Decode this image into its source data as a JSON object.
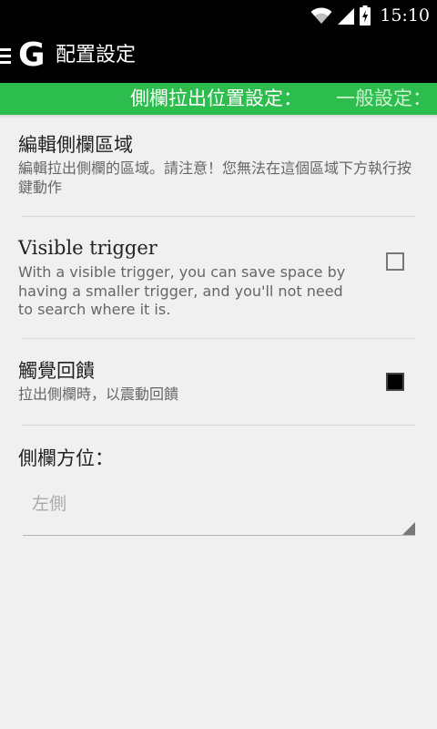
{
  "status_bar": {
    "time": "15:10",
    "icons": [
      "wifi-icon",
      "cell-signal-icon",
      "battery-charging-icon"
    ]
  },
  "action_bar": {
    "menu_icon": "hamburger-icon",
    "logo": "G",
    "title": "配置設定"
  },
  "tabs": {
    "active": "側欄拉出位置設定：",
    "inactive": "一般設定："
  },
  "preferences": {
    "edit_area": {
      "title": "編輯側欄區域",
      "summary": "編輯拉出側欄的區域。請注意！您無法在這個區域下方執行按鍵動作"
    },
    "visible_trigger": {
      "title": "Visible trigger",
      "summary": "With a visible trigger, you can save space by having a smaller trigger, and you'll not need to search where it is.",
      "checked": false
    },
    "haptic_feedback": {
      "title": "觸覺回饋",
      "summary": "拉出側欄時，以震動回饋",
      "checked": true
    },
    "sidebar_side": {
      "title": "側欄方位：",
      "value": "左側"
    }
  },
  "colors": {
    "tab_strip": "#2dbd4e",
    "bar_background": "#000000",
    "page_background": "#f0f0f0"
  }
}
